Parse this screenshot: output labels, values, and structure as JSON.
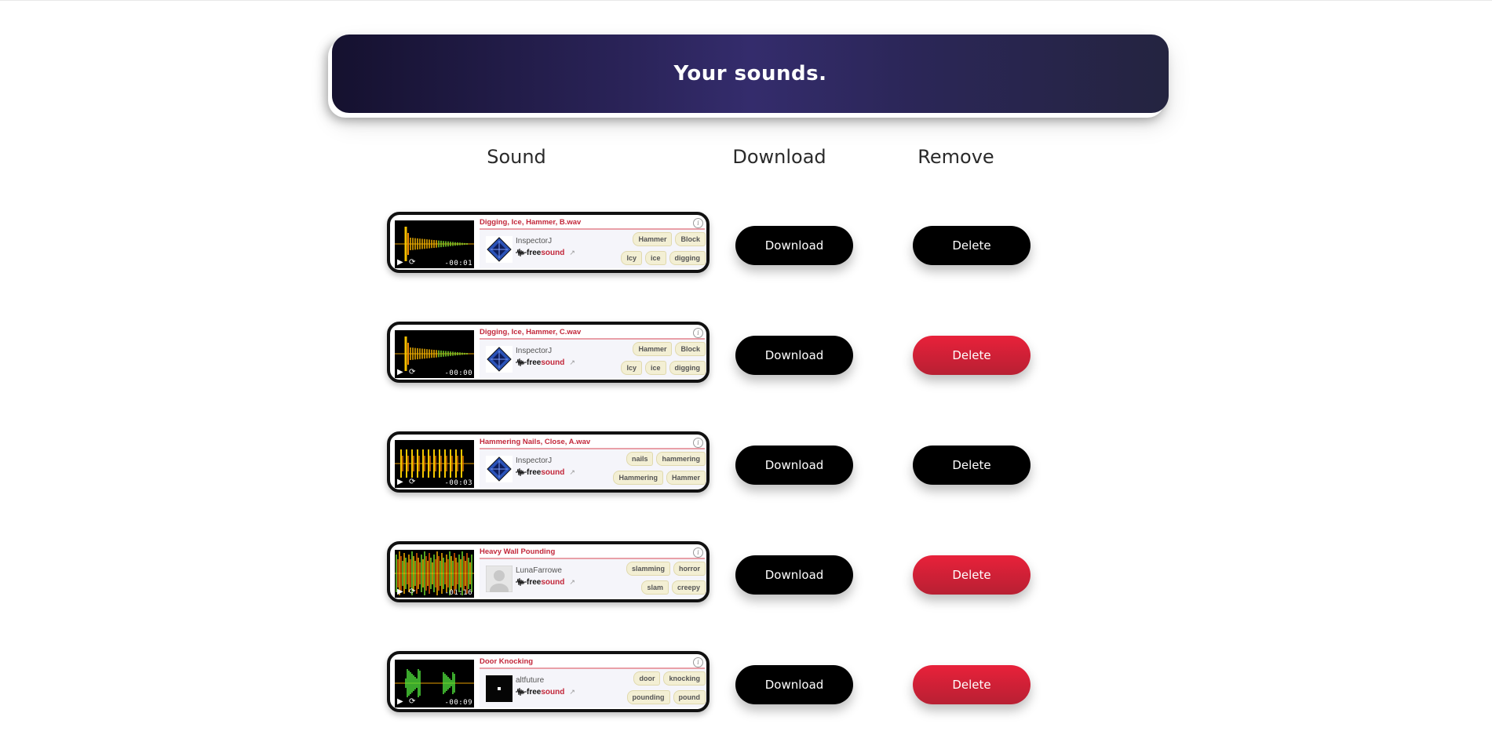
{
  "header": {
    "title": "Your sounds."
  },
  "columns": {
    "sound": "Sound",
    "download": "Download",
    "remove": "Remove"
  },
  "colors": {
    "accent_red": "#e8213a",
    "header_dark": "#15112f",
    "freesound_red": "#c2273a"
  },
  "rows": [
    {
      "title": "Digging, Ice, Hammer, B.wav",
      "user": "InspectorJ",
      "time": "-00:01",
      "tags_top": [
        "Hammer",
        "Block"
      ],
      "tags_bottom": [
        "Icy",
        "ice",
        "digging"
      ],
      "download_label": "Download",
      "delete_label": "Delete",
      "delete_active": false
    },
    {
      "title": "Digging, Ice, Hammer, C.wav",
      "user": "InspectorJ",
      "time": "-00:00",
      "tags_top": [
        "Hammer",
        "Block"
      ],
      "tags_bottom": [
        "Icy",
        "ice",
        "digging"
      ],
      "download_label": "Download",
      "delete_label": "Delete",
      "delete_active": true
    },
    {
      "title": "Hammering Nails, Close, A.wav",
      "user": "InspectorJ",
      "time": "-00:03",
      "tags_top": [
        "nails",
        "hammering"
      ],
      "tags_bottom": [
        "Hammering",
        "Hammer"
      ],
      "download_label": "Download",
      "delete_label": "Delete",
      "delete_active": false
    },
    {
      "title": "Heavy Wall Pounding",
      "user": "LunaFarrowe",
      "time": "-01:16",
      "tags_top": [
        "slamming",
        "horror"
      ],
      "tags_bottom": [
        "slam",
        "creepy"
      ],
      "download_label": "Download",
      "delete_label": "Delete",
      "delete_active": true
    },
    {
      "title": "Door Knocking",
      "user": "altfuture",
      "time": "-00:09",
      "tags_top": [
        "door",
        "knocking"
      ],
      "tags_bottom": [
        "pounding",
        "pound"
      ],
      "download_label": "Download",
      "delete_label": "Delete",
      "delete_active": true
    }
  ],
  "brand": {
    "free": "free",
    "sound": "sound"
  },
  "icons": {
    "play": "play-icon",
    "replay": "replay-icon",
    "info": "info-icon",
    "external": "external-link-icon"
  }
}
